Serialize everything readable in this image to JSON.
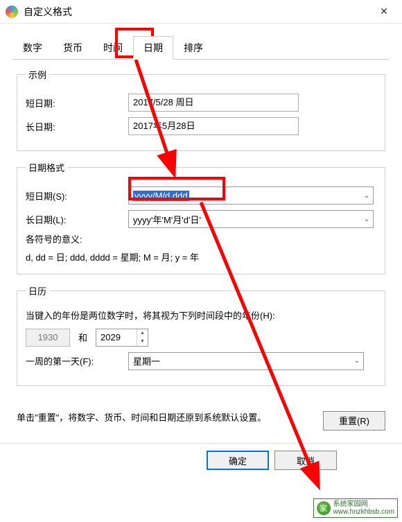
{
  "window": {
    "title": "自定义格式",
    "close_icon": "close-icon"
  },
  "tabs": [
    "数字",
    "货币",
    "时间",
    "日期",
    "排序"
  ],
  "active_tab_index": 3,
  "example": {
    "legend": "示例",
    "short_label": "短日期:",
    "short_value": "2017/5/28 周日",
    "long_label": "长日期:",
    "long_value": "2017年5月28日"
  },
  "format": {
    "legend": "日期格式",
    "short_label": "短日期(S):",
    "short_value": "yyyy/M/d ddd",
    "long_label": "长日期(L):",
    "long_value": "yyyy'年'M'月'd'日'",
    "meaning_label": "各符号的意义:",
    "meaning_text": "d, dd = 日;  ddd, dddd = 星期;  M = 月;  y = 年"
  },
  "calendar": {
    "legend": "日历",
    "two_digit_label": "当键入的年份是两位数字时，将其视为下列时间段中的年份(H):",
    "year_from": "1930",
    "and_label": "和",
    "year_to": "2029",
    "first_day_label": "一周的第一天(F):",
    "first_day_value": "星期一"
  },
  "reset": {
    "text": "单击\"重置\"，将数字、货币、时间和日期还原到系统默认设置。",
    "button": "重置(R)"
  },
  "buttons": {
    "ok": "确定",
    "cancel": "取消"
  },
  "watermark": {
    "name": "系统家园网",
    "url": "www.hnzkhbsb.com"
  }
}
